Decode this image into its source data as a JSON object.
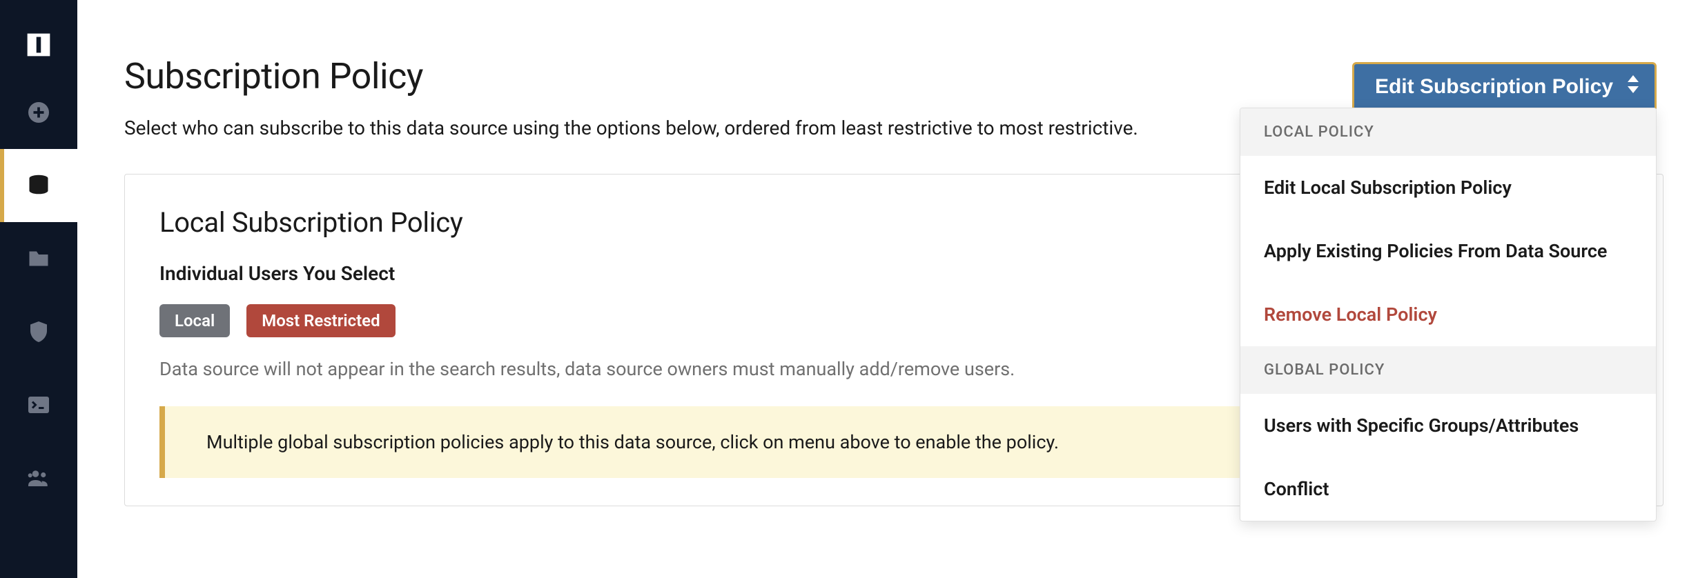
{
  "page": {
    "title": "Subscription Policy",
    "subtitle": "Select who can subscribe to this data source using the options below, ordered from least restrictive to most restrictive."
  },
  "card": {
    "title": "Local Subscription Policy",
    "subtitle": "Individual Users You Select",
    "badges": {
      "local": "Local",
      "most_restricted": "Most Restricted"
    },
    "desc": "Data source will not appear in the search results, data source owners must manually add/remove users.",
    "alert": "Multiple global subscription policies apply to this data source, click on menu above to enable the policy."
  },
  "dropdown": {
    "button_label": "Edit Subscription Policy",
    "sections": {
      "local_header": "LOCAL POLICY",
      "global_header": "GLOBAL POLICY",
      "items": {
        "edit_local": "Edit Local Subscription Policy",
        "apply_existing": "Apply Existing Policies From Data Source",
        "remove_local": "Remove Local Policy",
        "users_groups": "Users with Specific Groups/Attributes",
        "conflict": "Conflict"
      }
    }
  },
  "sidebar": {
    "items": [
      "logo",
      "add",
      "database",
      "folder",
      "shield",
      "terminal",
      "users"
    ]
  }
}
